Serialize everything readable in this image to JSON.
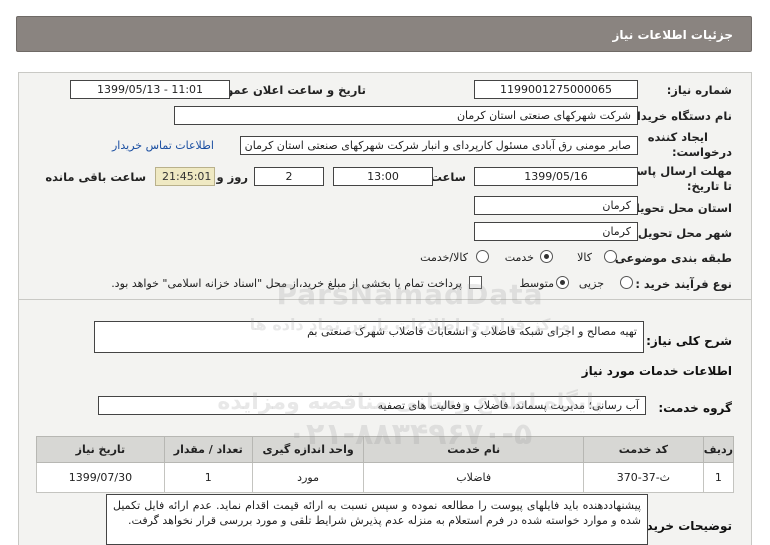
{
  "header": {
    "title": "جزئیات اطلاعات نیاز"
  },
  "fields": {
    "need_number_label": "شماره نیاز:",
    "need_number": "1199001275000065",
    "announce_label": "تاریخ و ساعت اعلان عمومی:",
    "announce_value": "1399/05/13 - 11:01",
    "buyer_label": "نام دستگاه خریدار:",
    "buyer_value": "شرکت شهرکهای صنعتی استان کرمان",
    "creator_label_1": "ایجاد کننده",
    "creator_label_2": "درخواست:",
    "creator_value": "صابر مومنی رق آبادی مسئول کارپردای و انبار شرکت شهرکهای صنعتی استان کرمان",
    "contact_link": "اطلاعات تماس خریدار",
    "deadline_label_1": "مهلت ارسال پاسخ:",
    "deadline_label_2": "تا تاریخ:",
    "deadline_date": "1399/05/16",
    "time_label": "ساعت",
    "deadline_time": "13:00",
    "days_value": "2",
    "days_label": "روز و",
    "remaining_time": "21:45:01",
    "remaining_label": "ساعت باقی مانده",
    "province_label": "استان محل تحویل:",
    "province_value": "کرمان",
    "city_label": "شهر محل تحویل:",
    "city_value": "کرمان",
    "category_label": "طبقه بندی موضوعی:",
    "category_options": [
      "کالا",
      "خدمت",
      "کالا/خدمت"
    ],
    "category_selected": "خدمت",
    "process_label": "نوع فرآیند خرید :",
    "process_options": [
      "جزیی",
      "متوسط"
    ],
    "process_selected": "متوسط",
    "payment_note": "پرداخت تمام یا بخشی از مبلغ خرید،از محل \"اسناد خزانه اسلامی\" خواهد بود."
  },
  "summary": {
    "label": "شرح کلی نیاز:",
    "value": "تهیه مصالح و اجرای شبکه فاضلاب و انشعابات فاضلاب شهرک صنعتی بم"
  },
  "services_section": {
    "title": "اطلاعات خدمات مورد نیاز"
  },
  "service_group": {
    "label": "گروه خدمت:",
    "value": "آب رسانی؛ مدیریت پسماند، فاضلاب و فعالیت های تصفیه"
  },
  "table": {
    "headers": [
      "ردیف",
      "کد خدمت",
      "نام خدمت",
      "واحد اندازه گیری",
      "تعداد / مقدار",
      "تاریخ نیاز"
    ],
    "rows": [
      [
        "1",
        "ث-37-370",
        "فاضلاب",
        "مورد",
        "1",
        "1399/07/30"
      ]
    ]
  },
  "buyer_notes": {
    "label": "توضیحات خریدار:",
    "value": "پیشنهاددهنده باید فایلهای پیوست را مطالعه نموده و سپس نسبت به ارائه قیمت اقدام نماید. عدم ارائه فایل تکمیل شده و موارد خواسته شده در فرم استعلام به منزله عدم پذیرش شرایط تلقی و مورد بررسی قرار نخواهد گرفت."
  },
  "watermark": {
    "line1": "ParsNamadData",
    "line2": "مرکز فراوری اطلاعات پارس نماد داده ها",
    "line3": "پایگاه اطلاع رسانی مناقصه ومزایده",
    "line4": "",
    "line5": "۰۲۱-۸۸۳۴۹۶۷۰-۵"
  }
}
